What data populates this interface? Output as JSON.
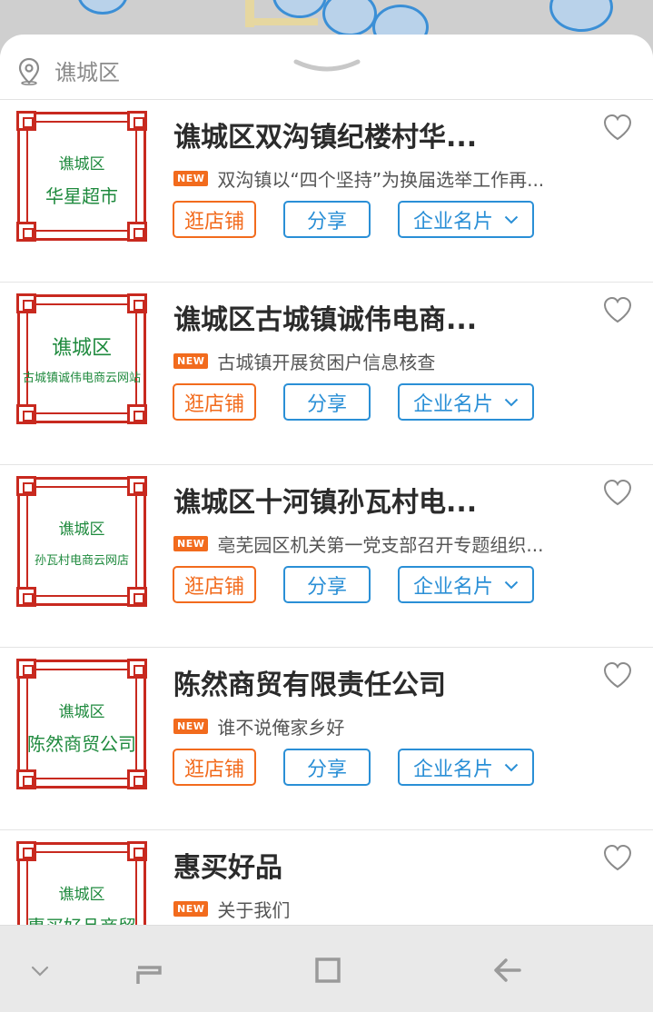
{
  "location": {
    "label": "谯城区"
  },
  "actions": {
    "shop": "逛店铺",
    "share": "分享",
    "card": "企业名片"
  },
  "badge": "NEW",
  "items": [
    {
      "title": "谯城区双沟镇纪楼村华...",
      "news": "双沟镇以“四个坚持”为换届选举工作再...",
      "logo_line1": "谯城区",
      "logo_line2": "华星超市"
    },
    {
      "title": "谯城区古城镇诚伟电商...",
      "news": "古城镇开展贫困户信息核查",
      "logo_line1": "谯城区",
      "logo_line2": "古城镇诚伟电商云网站"
    },
    {
      "title": "谯城区十河镇孙瓦村电...",
      "news": "亳芜园区机关第一党支部召开专题组织...",
      "logo_line1": "谯城区",
      "logo_line2": "孙瓦村电商云网店"
    },
    {
      "title": "陈然商贸有限责任公司",
      "news": "谁不说俺家乡好",
      "logo_line1": "谯城区",
      "logo_line2": "陈然商贸公司"
    },
    {
      "title": "惠买好品",
      "news": "关于我们",
      "logo_line1": "谯城区",
      "logo_line2": "惠买好品商贸"
    }
  ],
  "colors": {
    "accent_orange": "#f26b1d",
    "accent_blue": "#2a8fd6",
    "logo_red": "#c8291f",
    "logo_green": "#1f8a3e"
  }
}
